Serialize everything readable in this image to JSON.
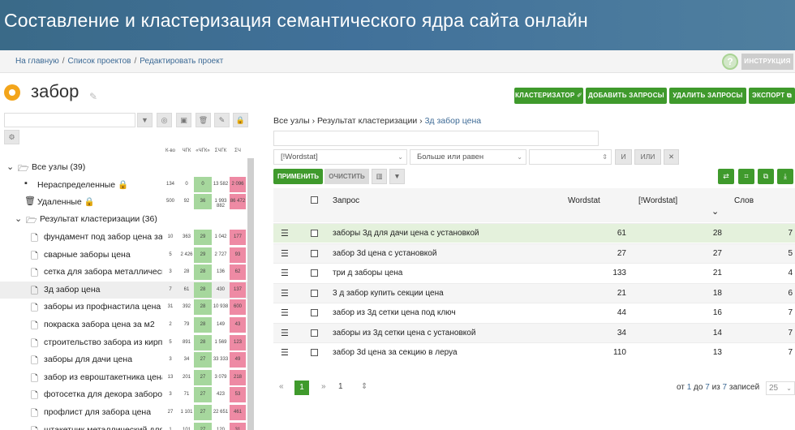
{
  "header": {
    "title": "Составление и кластеризация семантического ядра сайта онлайн"
  },
  "breadcrumb": [
    {
      "label": "На главную"
    },
    {
      "label": "Список проектов"
    },
    {
      "label": "Редактировать проект"
    }
  ],
  "help": {
    "icon": "question-icon",
    "label": "?"
  },
  "instruction_label": "ИНСТРУКЦИЯ",
  "project": {
    "title": "забор"
  },
  "actions": {
    "clusterizer": "КЛАСТЕРИЗАТОР ✐",
    "add": "ДОБАВИТЬ ЗАПРОСЫ ⌄",
    "delete": "УДАЛИТЬ ЗАПРОСЫ ⌄",
    "export": "ЭКСПОРТ ⧉"
  },
  "tree": {
    "columns": [
      "К-во",
      "ЧГК",
      "«ЧГК»",
      "ΣЧГК",
      "ΣЧ"
    ],
    "items": [
      {
        "label": "Все узлы (39)",
        "n": [
          "",
          "",
          "",
          "",
          ""
        ]
      },
      {
        "label": "Нераспределенные 🔒",
        "n": [
          "134",
          "0",
          "0",
          "13 582",
          "2 096"
        ]
      },
      {
        "label": "Удаленные 🔒",
        "n": [
          "500",
          "92",
          "36",
          "1 993 882",
          "86 472"
        ]
      },
      {
        "label": "Результат кластеризации (36)",
        "n": [
          "",
          "",
          "",
          "",
          ""
        ]
      },
      {
        "label": "фундамент под забор цена за пс",
        "n": [
          "10",
          "363",
          "29",
          "1 042",
          "177"
        ]
      },
      {
        "label": "сварные заборы цена",
        "n": [
          "5",
          "2 426",
          "29",
          "2 727",
          "93"
        ]
      },
      {
        "label": "сетка для забора металлическая",
        "n": [
          "3",
          "28",
          "28",
          "136",
          "62"
        ]
      },
      {
        "label": "3д забор цена",
        "n": [
          "7",
          "61",
          "28",
          "430",
          "137"
        ]
      },
      {
        "label": "заборы из профнастила цена с у",
        "n": [
          "31",
          "392",
          "28",
          "10 938",
          "600"
        ]
      },
      {
        "label": "покраска забора цена за м2",
        "n": [
          "2",
          "79",
          "28",
          "149",
          "43"
        ]
      },
      {
        "label": "строительство забора из кирпич",
        "n": [
          "5",
          "891",
          "28",
          "1 569",
          "123"
        ]
      },
      {
        "label": "заборы для дачи цена",
        "n": [
          "3",
          "34",
          "27",
          "33 333",
          "49"
        ]
      },
      {
        "label": "забор из евроштакетника цена",
        "n": [
          "13",
          "201",
          "27",
          "3 079",
          "218"
        ]
      },
      {
        "label": "фотосетка для декора заборов ф",
        "n": [
          "3",
          "71",
          "27",
          "423",
          "53"
        ]
      },
      {
        "label": "профлист для забора цена",
        "n": [
          "27",
          "1 101",
          "27",
          "22 651",
          "461"
        ]
      },
      {
        "label": "штакетник металлический для з",
        "n": [
          "1",
          "101",
          "27",
          "120",
          "31"
        ]
      }
    ]
  },
  "right": {
    "crumbs": [
      {
        "label": "Все узлы"
      },
      {
        "label": "Результат кластеризации"
      },
      {
        "label": "3д забор цена"
      }
    ],
    "filter_field": "[!Wordstat]",
    "filter_operator": "Больше или равен",
    "filter_value": "",
    "and_label": "И",
    "or_label": "ИЛИ",
    "remove_label": "✕",
    "apply": "ПРИМЕНИТЬ",
    "clear": "ОЧИСТИТЬ"
  },
  "table": {
    "headers": [
      "Запрос",
      "Wordstat",
      "[!Wordstat]",
      "Слов"
    ],
    "rows": [
      {
        "q": "заборы 3д для дачи цена с установкой",
        "w": "61",
        "ew": "28",
        "s": "7"
      },
      {
        "q": "забор 3d цена с установкой",
        "w": "27",
        "ew": "27",
        "s": "5"
      },
      {
        "q": "три д заборы цена",
        "w": "133",
        "ew": "21",
        "s": "4"
      },
      {
        "q": "3 д забор купить секции цена",
        "w": "21",
        "ew": "18",
        "s": "6"
      },
      {
        "q": "забор из 3д сетки цена под ключ",
        "w": "44",
        "ew": "16",
        "s": "7"
      },
      {
        "q": "заборы из 3д сетки цена с установкой",
        "w": "34",
        "ew": "14",
        "s": "7"
      },
      {
        "q": "забор 3d цена за секцию в леруа",
        "w": "110",
        "ew": "13",
        "s": "7"
      }
    ]
  },
  "pagination": {
    "first": "«",
    "page": "1",
    "next": "»",
    "goto": "1",
    "info_prefix": "от",
    "info_from": "1",
    "info_mid1": "до",
    "info_to": "7",
    "info_mid2": "из",
    "info_total": "7",
    "info_suffix": "записей",
    "page_size": "25"
  }
}
